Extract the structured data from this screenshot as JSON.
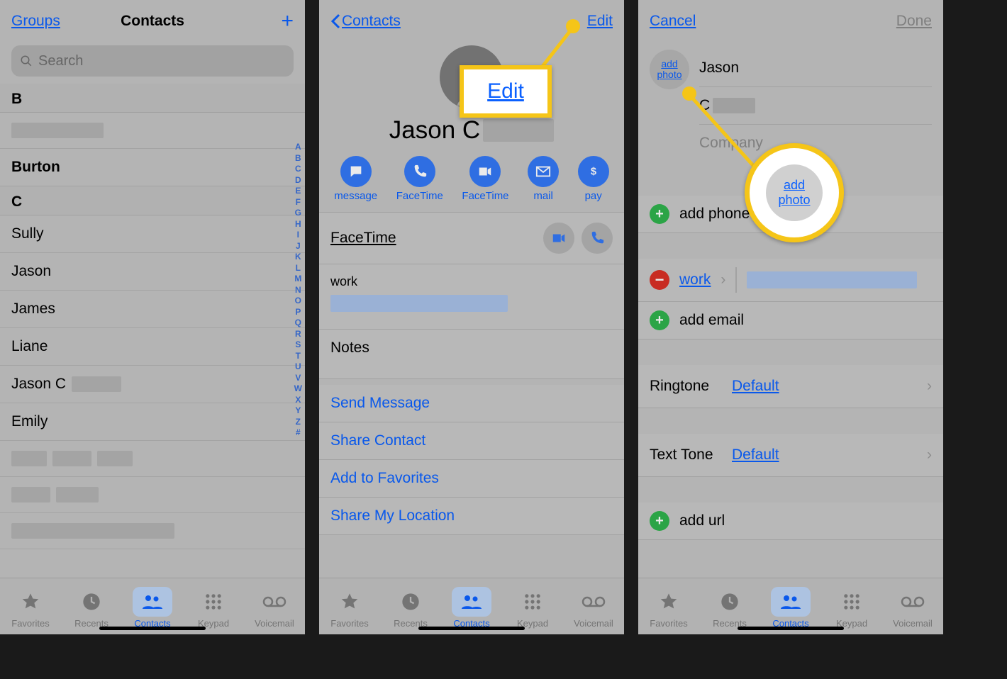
{
  "panel1": {
    "groups": "Groups",
    "title": "Contacts",
    "search_ph": "Search",
    "sections": [
      {
        "letter": "B",
        "rows": [
          "",
          "Burton"
        ]
      },
      {
        "letter": "C",
        "rows": [
          "Sully",
          "Jason",
          "James",
          "Liane",
          "Jason C",
          "Emily"
        ]
      }
    ],
    "alpha": [
      "A",
      "B",
      "C",
      "D",
      "E",
      "F",
      "G",
      "H",
      "I",
      "J",
      "K",
      "L",
      "M",
      "N",
      "O",
      "P",
      "Q",
      "R",
      "S",
      "T",
      "U",
      "V",
      "W",
      "X",
      "Y",
      "Z",
      "#"
    ]
  },
  "panel2": {
    "back": "Contacts",
    "edit": "Edit",
    "name_prefix": "Jason C",
    "actions": [
      "message",
      "FaceTime",
      "FaceTime",
      "mail",
      "pay"
    ],
    "ft_label": "FaceTime",
    "work_label": "work",
    "notes_label": "Notes",
    "links": [
      "Send Message",
      "Share Contact",
      "Add to Favorites",
      "Share My Location"
    ],
    "callout_text": "Edit"
  },
  "panel3": {
    "cancel": "Cancel",
    "done": "Done",
    "addphoto": "add photo",
    "first": "Jason",
    "last_initial": "C",
    "company_ph": "Company",
    "addphone": "add phone",
    "worklabel": "work",
    "addemail": "add email",
    "ringtone_k": "Ringtone",
    "ringtone_v": "Default",
    "texttone_k": "Text Tone",
    "texttone_v": "Default",
    "addurl": "add url",
    "callout_text": "add photo"
  },
  "tabs": [
    "Favorites",
    "Recents",
    "Contacts",
    "Keypad",
    "Voicemail"
  ]
}
